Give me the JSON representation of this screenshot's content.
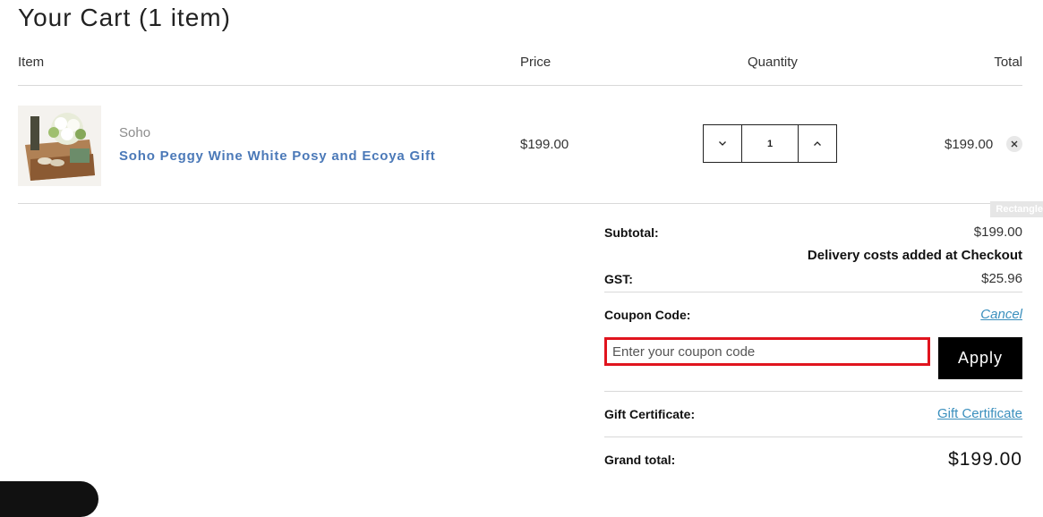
{
  "cart": {
    "title": "Your Cart (1 item)"
  },
  "table": {
    "headers": {
      "item": "Item",
      "price": "Price",
      "quantity": "Quantity",
      "total": "Total"
    },
    "rows": [
      {
        "brand": "Soho",
        "name": "Soho Peggy Wine White Posy and Ecoya Gift",
        "price": "$199.00",
        "quantity": "1",
        "total": "$199.00"
      }
    ]
  },
  "tooltip": {
    "label": "Rectangle"
  },
  "summary": {
    "subtotal_label": "Subtotal:",
    "subtotal_value": "$199.00",
    "delivery_note": "Delivery costs added at Checkout",
    "gst_label": "GST:",
    "gst_value": "$25.96",
    "coupon_label": "Coupon Code:",
    "coupon_cancel": "Cancel",
    "coupon_placeholder": "Enter your coupon code",
    "apply_label": "Apply",
    "gift_label": "Gift Certificate:",
    "gift_link": "Gift Certificate",
    "grand_label": "Grand total:",
    "grand_value": "$199.00"
  },
  "icons": {
    "decrease": "chevron-down-icon",
    "increase": "chevron-up-icon",
    "remove": "close-icon"
  },
  "colors": {
    "product_link": "#4b79b8",
    "link": "#3a8fbd",
    "highlight": "#e0141e",
    "apply_bg": "#000000"
  }
}
